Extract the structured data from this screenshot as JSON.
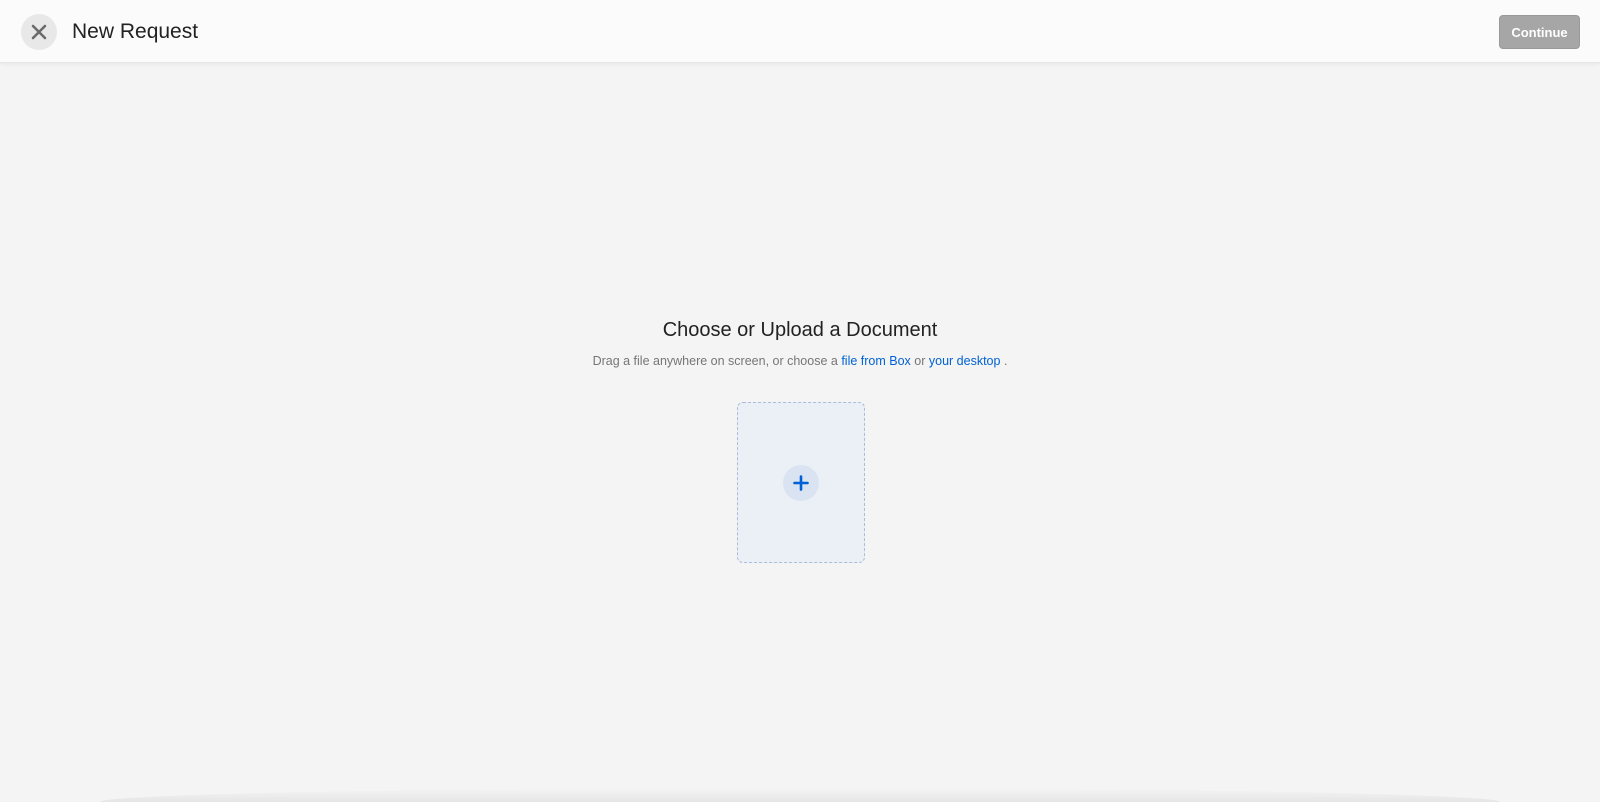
{
  "header": {
    "title": "New Request",
    "close_icon": "close-icon",
    "continue_label": "Continue"
  },
  "main": {
    "heading": "Choose or Upload a Document",
    "instructions_prefix": "Drag a file anywhere on screen, or choose a",
    "link_box": "file from Box",
    "instructions_or": "or",
    "link_desktop": "your desktop",
    "instructions_suffix": ".",
    "dropzone_icon": "plus-icon"
  },
  "colors": {
    "link": "#0061d5",
    "continue_disabled": "#a6a6a6",
    "background": "#f4f4f4",
    "dropzone": "#ebeff6"
  }
}
